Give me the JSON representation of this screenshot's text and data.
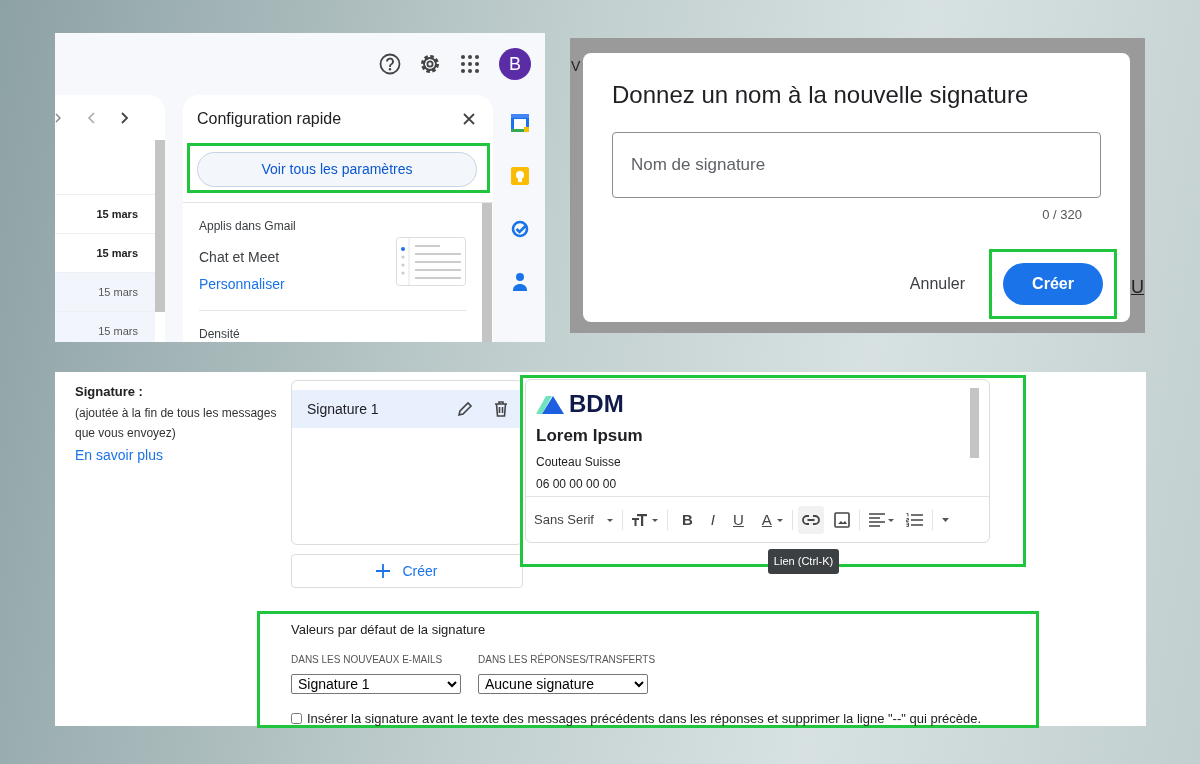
{
  "gmail_panel": {
    "avatar": {
      "letter": "B"
    },
    "mail_list": {
      "rows": [
        {
          "date": "15 mars",
          "unread": true
        },
        {
          "date": "15 mars",
          "unread": true
        },
        {
          "date": "15 mars",
          "unread": false
        },
        {
          "date": "15 mars",
          "unread": false
        }
      ]
    },
    "quick_settings": {
      "title": "Configuration rapide",
      "all_settings_button": {
        "label": "Voir tous les paramètres",
        "highlighted": true
      },
      "sections": [
        {
          "heading": "Applis dans Gmail",
          "item": "Chat et Meet",
          "link": "Personnaliser"
        },
        {
          "heading": "Densité"
        }
      ]
    }
  },
  "name_dialog": {
    "backdrop_texts": [
      "V",
      "U"
    ],
    "title": "Donnez un nom à la nouvelle signature",
    "field": {
      "placeholder": "Nom de signature"
    },
    "counter": "0 / 320",
    "buttons": [
      {
        "label": "Annuler",
        "kind": "text",
        "highlighted": false
      },
      {
        "label": "Créer",
        "kind": "filled",
        "highlighted": true
      }
    ]
  },
  "signature_settings": {
    "label": "Signature :",
    "description": "(ajoutée à la fin de tous les messages que vous envoyez)",
    "learn_more": "En savoir plus",
    "signatures": [
      {
        "name": "Signature 1",
        "selected": true
      }
    ],
    "create_button": "Créer",
    "editor": {
      "highlighted": true,
      "logo_text": "BDM",
      "name": "Lorem Ipsum",
      "lines": [
        "Couteau Suisse",
        "06 00 00 00 00"
      ],
      "toolbar": [
        {
          "kind": "font",
          "label": "Sans Serif"
        },
        {
          "kind": "size"
        },
        {
          "kind": "bold",
          "label": "B"
        },
        {
          "kind": "italic",
          "label": "I"
        },
        {
          "kind": "underline",
          "label": "U"
        },
        {
          "kind": "color",
          "label": "A"
        },
        {
          "kind": "link",
          "tooltip": "Lien (Ctrl-K)"
        },
        {
          "kind": "image"
        },
        {
          "kind": "align"
        },
        {
          "kind": "list"
        },
        {
          "kind": "more"
        }
      ]
    },
    "defaults": {
      "highlighted": true,
      "title": "Valeurs par défaut de la signature",
      "columns": [
        {
          "label": "DANS LES NOUVEAUX E-MAILS",
          "value": "Signature 1"
        },
        {
          "label": "DANS LES RÉPONSES/TRANSFERTS",
          "value": "Aucune signature"
        }
      ],
      "insert_before": {
        "label": "Insérer la signature avant le texte des messages précédents dans les réponses et supprimer la ligne \"--\" qui précède.",
        "checked": false
      }
    }
  }
}
